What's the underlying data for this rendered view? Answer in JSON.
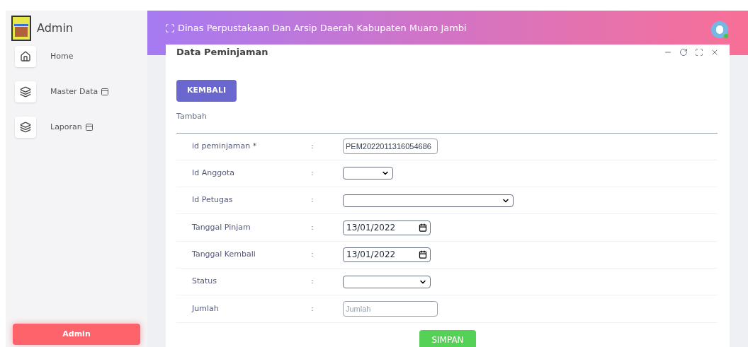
{
  "sidebar": {
    "title": "Admin",
    "items": [
      {
        "label": "Home"
      },
      {
        "label": "Master Data"
      },
      {
        "label": "Laporan"
      }
    ],
    "footer_button": "Admin"
  },
  "header": {
    "title": "Dinas Perpustakaan Dan Arsip Daerah Kabupaten Muaro Jambi"
  },
  "card": {
    "title": "Data Peminjaman",
    "back_button": "KEMBALI",
    "section": "Tambah",
    "fields": [
      {
        "label": "id peminjaman *",
        "separator": ":",
        "kind": "text",
        "value": "PEM2022011316054686"
      },
      {
        "label": "Id Anggota",
        "separator": ":",
        "kind": "select"
      },
      {
        "label": "Id Petugas",
        "separator": ":",
        "kind": "select"
      },
      {
        "label": "Tanggal Pinjam",
        "separator": ":",
        "kind": "date",
        "value": "13/01/2022"
      },
      {
        "label": "Tanggal Kembali",
        "separator": ":",
        "kind": "date",
        "value": "13/01/2022"
      },
      {
        "label": "Status",
        "separator": ":",
        "kind": "select"
      },
      {
        "label": "Jumlah",
        "separator": ":",
        "kind": "text",
        "placeholder": "Jumlah"
      }
    ],
    "submit_button": "SIMPAN"
  }
}
